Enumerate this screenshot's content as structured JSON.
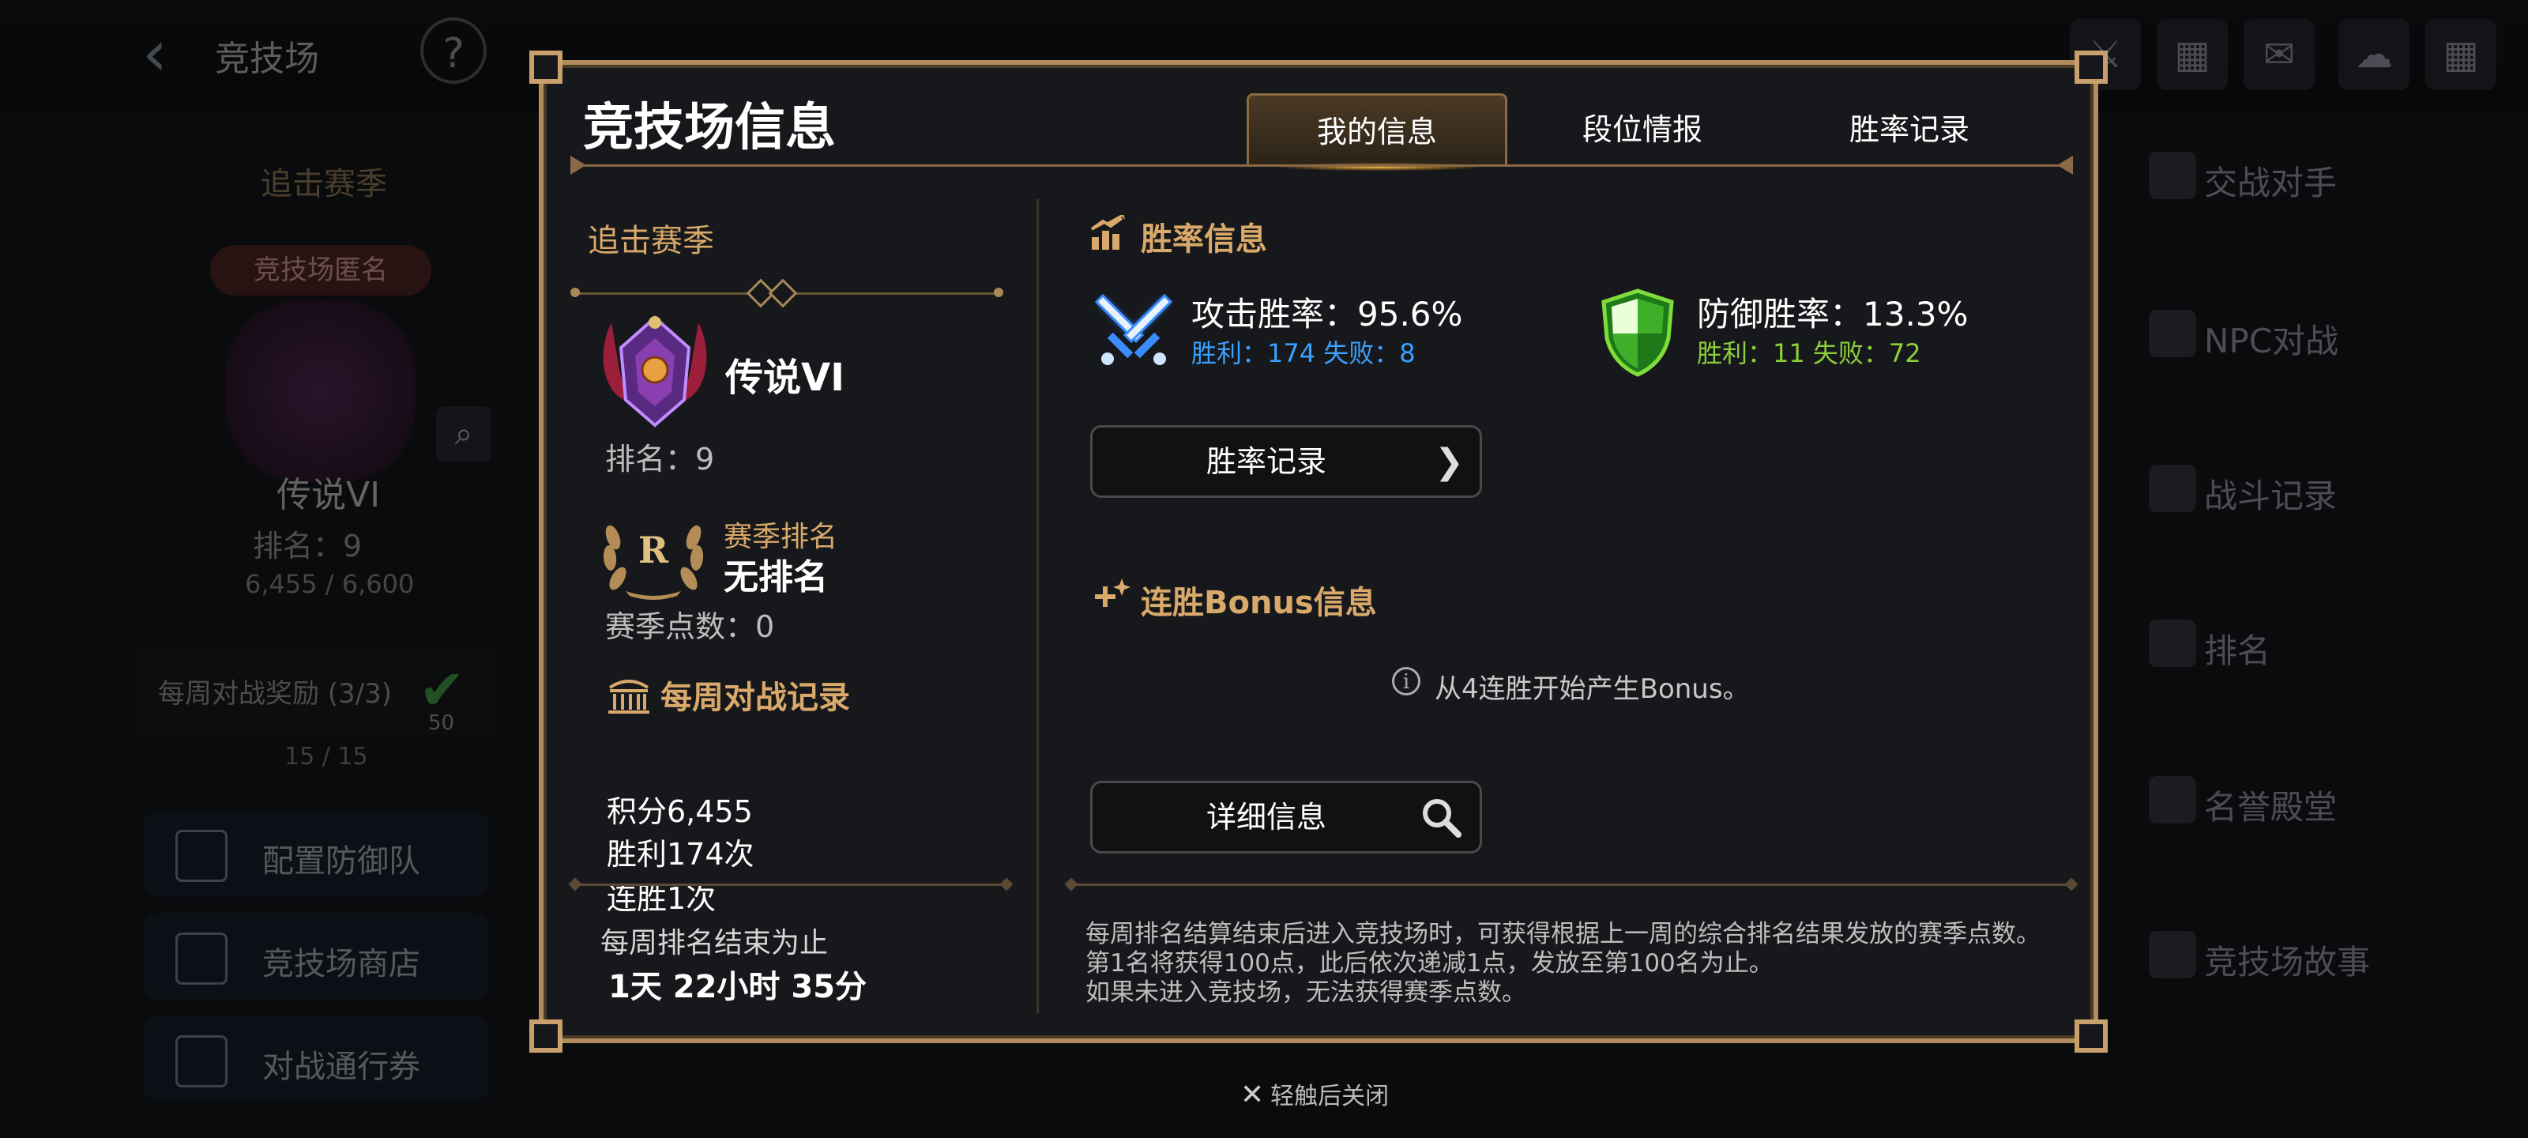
{
  "background": {
    "screen_title": "竞技场",
    "help": "?",
    "left_panel": {
      "season": "追击赛季",
      "tag": "竞技场匿名",
      "tier": "传说VI",
      "rank": "排名：9",
      "points": "6,455 / 6,600",
      "weekly_reward": "每周对战奖励 (3/3)",
      "weekly_reward_badge": "50",
      "progress": "15 / 15",
      "buttons": [
        "配置防御队",
        "竞技场商店",
        "对战通行券"
      ]
    },
    "right_menu": [
      "交战对手",
      "NPC对战",
      "战斗记录",
      "排名",
      "名誉殿堂",
      "竞技场故事"
    ]
  },
  "modal": {
    "title": "竞技场信息",
    "tabs": [
      "我的信息",
      "段位情报",
      "胜率记录"
    ],
    "active_tab": 0,
    "left": {
      "season": "追击赛季",
      "tier": "传说VI",
      "rank": "排名：9",
      "season_rank_label": "赛季排名",
      "season_rank_value": "无排名",
      "season_points": "赛季点数：0",
      "weekly_title": "每周对战记录",
      "stats": [
        "积分6,455",
        "胜利174次",
        "连胜1次"
      ],
      "week_end_label": "每周排名结束为止",
      "week_end_value": "1天 22小时 35分"
    },
    "right": {
      "winrate_title": "胜率信息",
      "attack_label": "攻击胜率：95.6%",
      "attack_detail": "胜利：174 失败：8",
      "defense_label": "防御胜率：13.3%",
      "defense_detail": "胜利：11 失败：72",
      "winrate_button": "胜率记录",
      "bonus_title": "连胜Bonus信息",
      "bonus_info": "从4连胜开始产生Bonus。",
      "detail_button": "详细信息",
      "note": "每周排名结算结束后进入竞技场时，可获得根据上一周的综合排名结果发放的赛季点数。第1名将获得100点，此后依次递减1点，发放至第100名为止。\n如果未进入竞技场，无法获得赛季点数。"
    },
    "colors": {
      "gold": "#d8a96a",
      "attack_blue": "#3aa0ff",
      "defense_green": "#8ccf3a",
      "frame": "#b28b5e"
    }
  },
  "close_hint": "轻触后关闭"
}
